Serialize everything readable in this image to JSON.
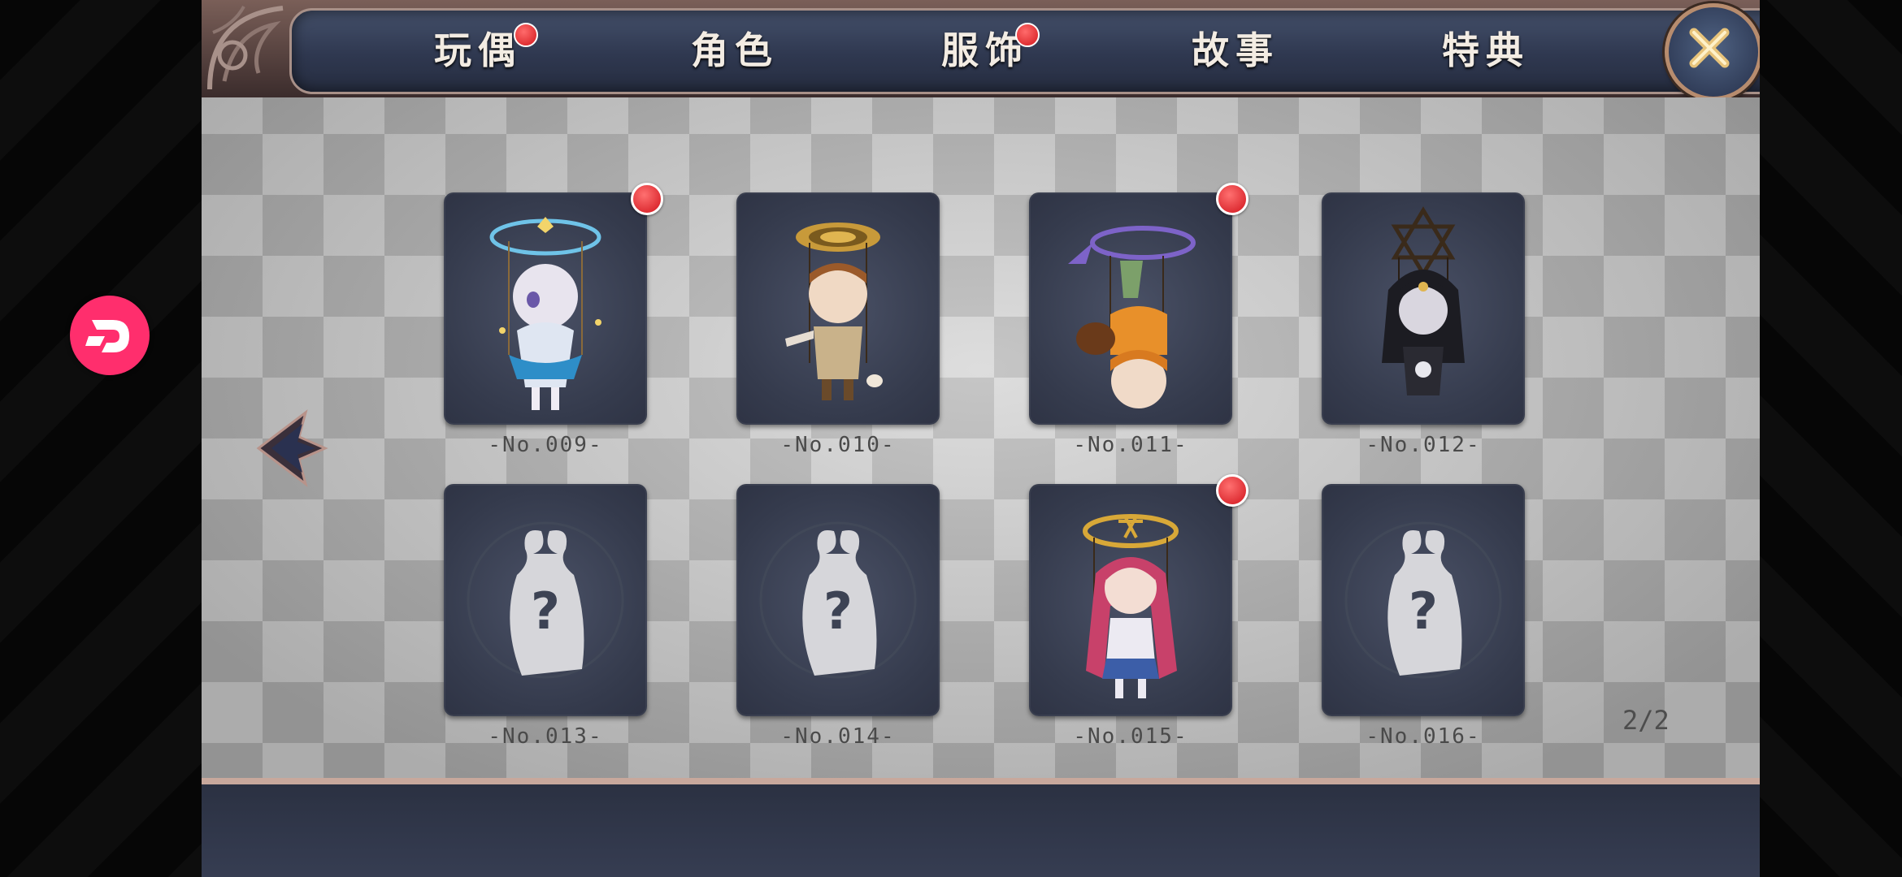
{
  "tabs": [
    {
      "label": "玩偶",
      "has_notification": true
    },
    {
      "label": "角色",
      "has_notification": false
    },
    {
      "label": "服饰",
      "has_notification": true
    },
    {
      "label": "故事",
      "has_notification": false
    },
    {
      "label": "特典",
      "has_notification": false
    }
  ],
  "icons": {
    "close": "close-icon",
    "prev": "left-arrow-icon",
    "floating": "app-logo-icon",
    "locked": "locked-puppet-silhouette-icon"
  },
  "cards": [
    {
      "label": "-No.009-",
      "unlocked": true,
      "new": true,
      "figure": "white-haired-puppet-blue-halo"
    },
    {
      "label": "-No.010-",
      "unlocked": true,
      "new": false,
      "figure": "brown-haired-puppet-spiral-halo"
    },
    {
      "label": "-No.011-",
      "unlocked": true,
      "new": true,
      "figure": "upside-down-puppet-purple-halo"
    },
    {
      "label": "-No.012-",
      "unlocked": true,
      "new": false,
      "figure": "black-haired-puppet-star-halo"
    },
    {
      "label": "-No.013-",
      "unlocked": false,
      "new": false,
      "figure": "locked"
    },
    {
      "label": "-No.014-",
      "unlocked": false,
      "new": false,
      "figure": "locked"
    },
    {
      "label": "-No.015-",
      "unlocked": true,
      "new": true,
      "figure": "pink-haired-puppet-gold-halo"
    },
    {
      "label": "-No.016-",
      "unlocked": false,
      "new": false,
      "figure": "locked"
    }
  ],
  "page_indicator": "2/2",
  "colors": {
    "notification": "#d3181d",
    "card_bg": "#353b4d",
    "floating_button": "#ff2e6d"
  }
}
